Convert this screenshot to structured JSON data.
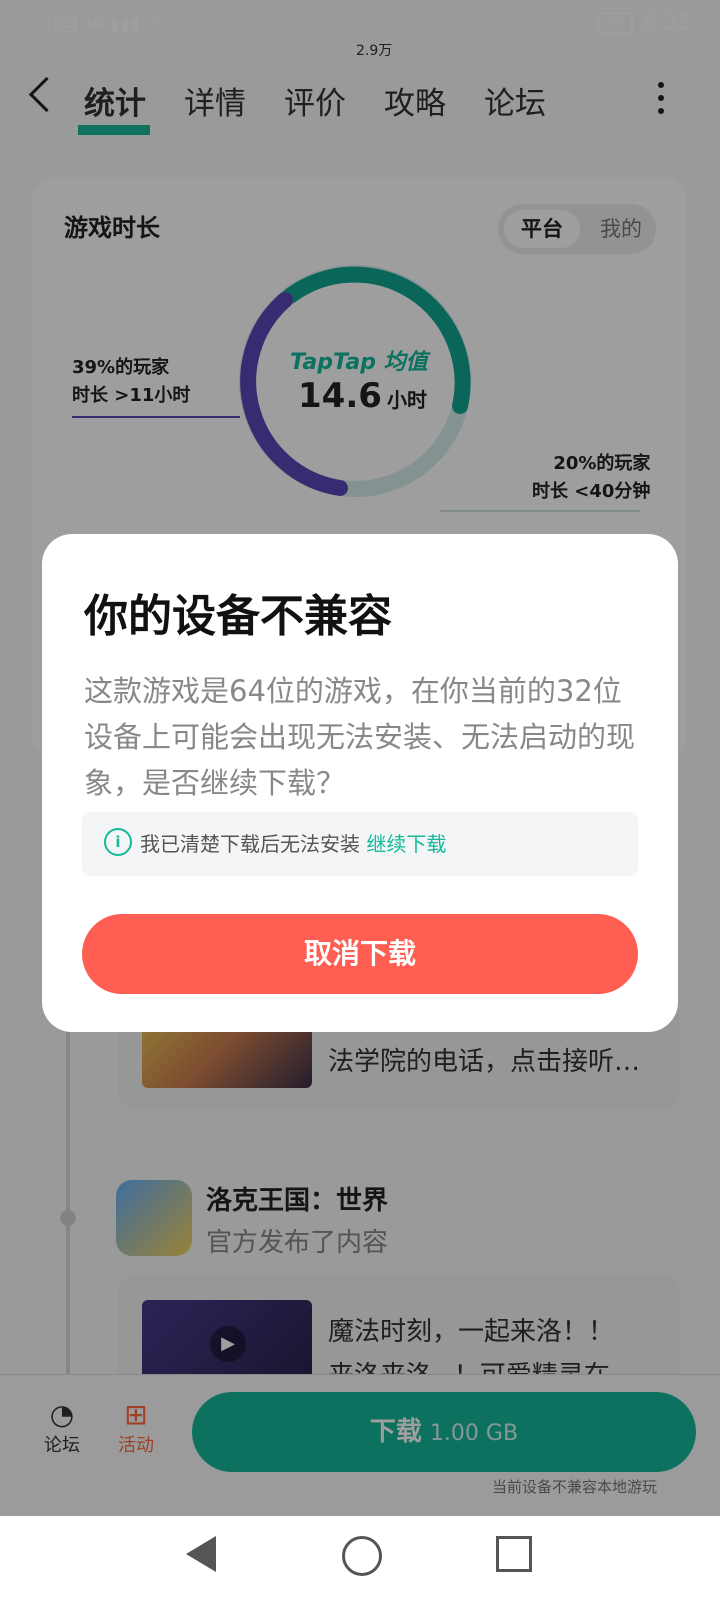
{
  "status_bar": {
    "signal": "4G",
    "hd": "HD",
    "battery": "42",
    "time": "6:35"
  },
  "nav": {
    "tabs": [
      "统计",
      "详情",
      "评价",
      "攻略",
      "论坛"
    ],
    "review_badge": "2.9万"
  },
  "playtime": {
    "title": "游戏时长",
    "toggle_platform": "平台",
    "toggle_mine": "我的",
    "brand": "TapTap 均值",
    "avg_value": "14.6",
    "avg_unit": "小时",
    "left_legend_1": "39%的玩家",
    "left_legend_2": "时长 >11小时",
    "right_legend_1": "20%的玩家",
    "right_legend_2": "时长 <40分钟"
  },
  "feed": {
    "item1_desc": "法学院的电话，点击接听…",
    "item2_title": "洛克王国：世界",
    "item2_sub": "官方发布了内容",
    "item2_desc_1": "魔法时刻，一起来洛！！",
    "item2_desc_2": "来洛来洛~！可爱精灵在"
  },
  "bottom": {
    "forum_label": "论坛",
    "activity_label": "活动",
    "download_label": "下载",
    "download_size": "1.00 GB",
    "compat_note": "当前设备不兼容本地游玩"
  },
  "dialog": {
    "title": "你的设备不兼容",
    "body": "这款游戏是64位的游戏，在你当前的32位设备上可能会出现无法安装、无法启动的现象，是否继续下载？",
    "notice_text": "我已清楚下载后无法安装",
    "notice_link": "继续下载",
    "cancel_button": "取消下载"
  }
}
